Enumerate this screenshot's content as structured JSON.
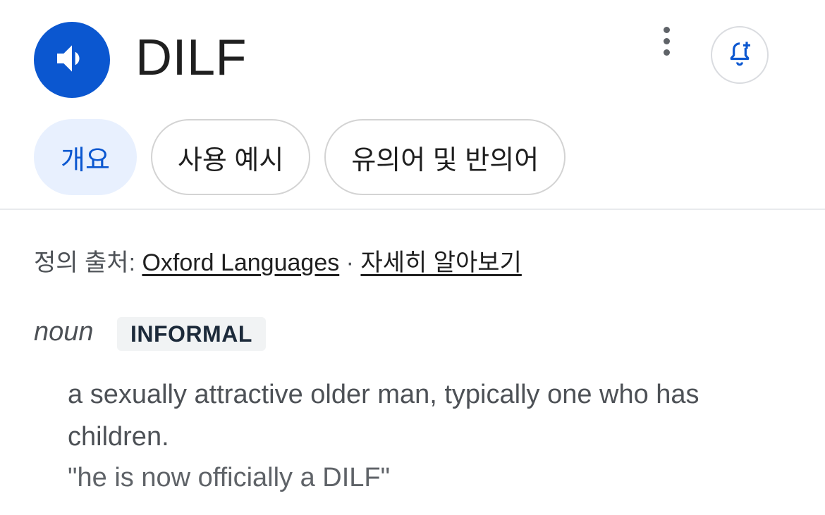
{
  "header": {
    "term": "DILF",
    "speaker_icon": "volume-icon",
    "more_icon": "more-vert-icon",
    "alert_icon": "add-alert-icon",
    "accent": "#0b57d0"
  },
  "tabs": [
    {
      "label": "개요",
      "active": true
    },
    {
      "label": "사용 예시",
      "active": false
    },
    {
      "label": "유의어 및 반의어",
      "active": false
    }
  ],
  "source": {
    "prefix": "정의 출처: ",
    "provider": "Oxford Languages",
    "separator": " · ",
    "learn_more": "자세히 알아보기"
  },
  "entry": {
    "part_of_speech": "noun",
    "register": "INFORMAL",
    "definition": "a sexually attractive older man, typically one who has children.",
    "example": "\"he is now officially a DILF\""
  }
}
